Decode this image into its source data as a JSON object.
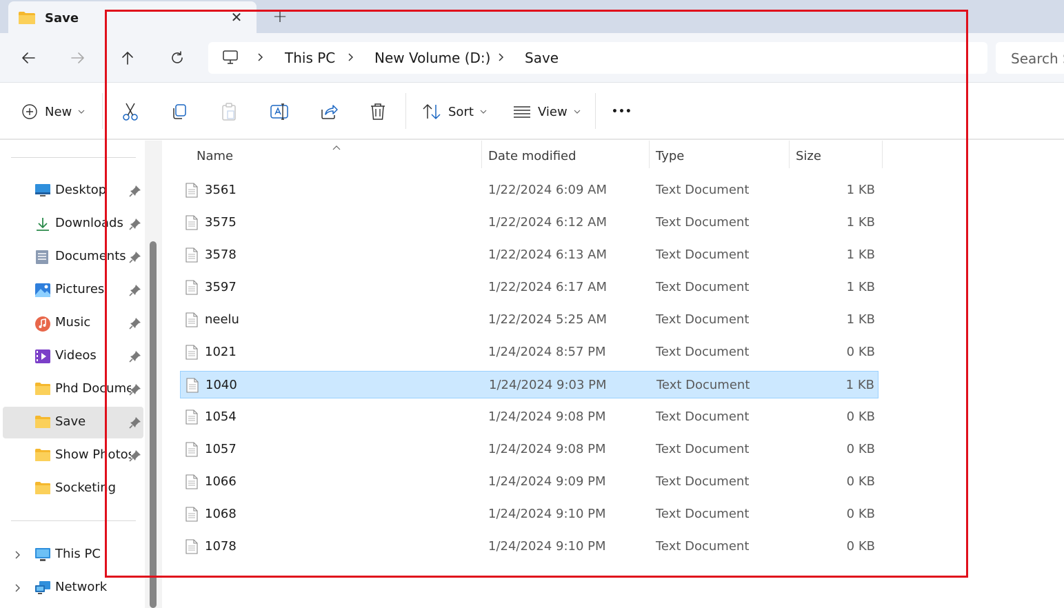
{
  "tab": {
    "title": "Save",
    "close_glyph": "✕",
    "new_tab_glyph": "+"
  },
  "address": {
    "breadcrumbs": [
      "This PC",
      "New Volume (D:)",
      "Save"
    ],
    "search_placeholder": "Search S"
  },
  "toolbar": {
    "new_label": "New",
    "sort_label": "Sort",
    "view_label": "View",
    "more_glyph": "•••"
  },
  "sidebar": {
    "quick_access": [
      {
        "label": "Desktop",
        "icon": "desktop-icon",
        "pinned": true
      },
      {
        "label": "Downloads",
        "icon": "downloads-icon",
        "pinned": true
      },
      {
        "label": "Documents",
        "icon": "documents-icon",
        "pinned": true
      },
      {
        "label": "Pictures",
        "icon": "pictures-icon",
        "pinned": true
      },
      {
        "label": "Music",
        "icon": "music-icon",
        "pinned": true
      },
      {
        "label": "Videos",
        "icon": "videos-icon",
        "pinned": true
      },
      {
        "label": "Phd Docume",
        "icon": "folder-icon",
        "pinned": true
      },
      {
        "label": "Save",
        "icon": "folder-icon",
        "pinned": true,
        "selected": true
      },
      {
        "label": "Show Photos",
        "icon": "folder-icon",
        "pinned": true
      },
      {
        "label": "Socketing",
        "icon": "folder-icon",
        "pinned": false
      }
    ],
    "locations": [
      {
        "label": "This PC",
        "icon": "this-pc-icon"
      },
      {
        "label": "Network",
        "icon": "network-icon"
      }
    ]
  },
  "columns": {
    "name": "Name",
    "date": "Date modified",
    "type": "Type",
    "size": "Size"
  },
  "files": [
    {
      "name": "3561",
      "date": "1/22/2024 6:09 AM",
      "type": "Text Document",
      "size": "1 KB"
    },
    {
      "name": "3575",
      "date": "1/22/2024 6:12 AM",
      "type": "Text Document",
      "size": "1 KB"
    },
    {
      "name": "3578",
      "date": "1/22/2024 6:13 AM",
      "type": "Text Document",
      "size": "1 KB"
    },
    {
      "name": "3597",
      "date": "1/22/2024 6:17 AM",
      "type": "Text Document",
      "size": "1 KB"
    },
    {
      "name": "neelu",
      "date": "1/22/2024 5:25 AM",
      "type": "Text Document",
      "size": "1 KB"
    },
    {
      "name": "1021",
      "date": "1/24/2024 8:57 PM",
      "type": "Text Document",
      "size": "0 KB"
    },
    {
      "name": "1040",
      "date": "1/24/2024 9:03 PM",
      "type": "Text Document",
      "size": "1 KB",
      "selected": true
    },
    {
      "name": "1054",
      "date": "1/24/2024 9:08 PM",
      "type": "Text Document",
      "size": "0 KB"
    },
    {
      "name": "1057",
      "date": "1/24/2024 9:08 PM",
      "type": "Text Document",
      "size": "0 KB"
    },
    {
      "name": "1066",
      "date": "1/24/2024 9:09 PM",
      "type": "Text Document",
      "size": "0 KB"
    },
    {
      "name": "1068",
      "date": "1/24/2024 9:10 PM",
      "type": "Text Document",
      "size": "0 KB"
    },
    {
      "name": "1078",
      "date": "1/24/2024 9:10 PM",
      "type": "Text Document",
      "size": "0 KB"
    }
  ],
  "colors": {
    "accent": "#0067c0",
    "selection_fill": "#cce8ff",
    "selection_border": "#99d1ff",
    "folder_yellow": "#f8c84a",
    "annotation_red": "#e0101c"
  }
}
